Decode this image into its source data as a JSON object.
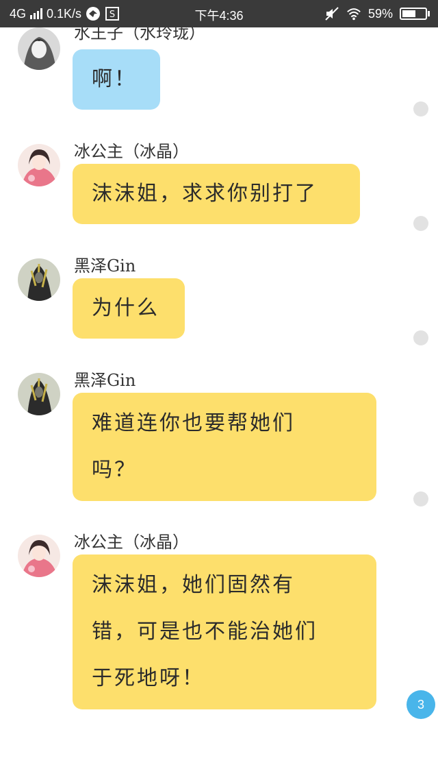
{
  "status_bar": {
    "network": "4G",
    "speed": "0.1K/s",
    "time": "下午4:36",
    "battery": "59%",
    "battery_level": 0.59
  },
  "messages": [
    {
      "sender": "水王子（水玲珑）",
      "lines": [
        "啊！"
      ],
      "bubble_color": "#a7ddf8"
    },
    {
      "sender": "冰公主（冰晶）",
      "lines": [
        "沫沫姐，求求你别打了"
      ],
      "bubble_color": "#fddf6c"
    },
    {
      "sender": "黑泽Gin",
      "lines": [
        "为什么"
      ],
      "bubble_color": "#fddf6c"
    },
    {
      "sender": "黑泽Gin",
      "lines": [
        "难道连你也要帮她们",
        "吗？"
      ],
      "bubble_color": "#fddf6c"
    },
    {
      "sender": "冰公主（冰晶）",
      "lines": [
        "沫沫姐，她们固然有",
        "错，可是也不能治她们",
        "于死地呀！"
      ],
      "bubble_color": "#fddf6c"
    }
  ],
  "unread_badge": "3"
}
